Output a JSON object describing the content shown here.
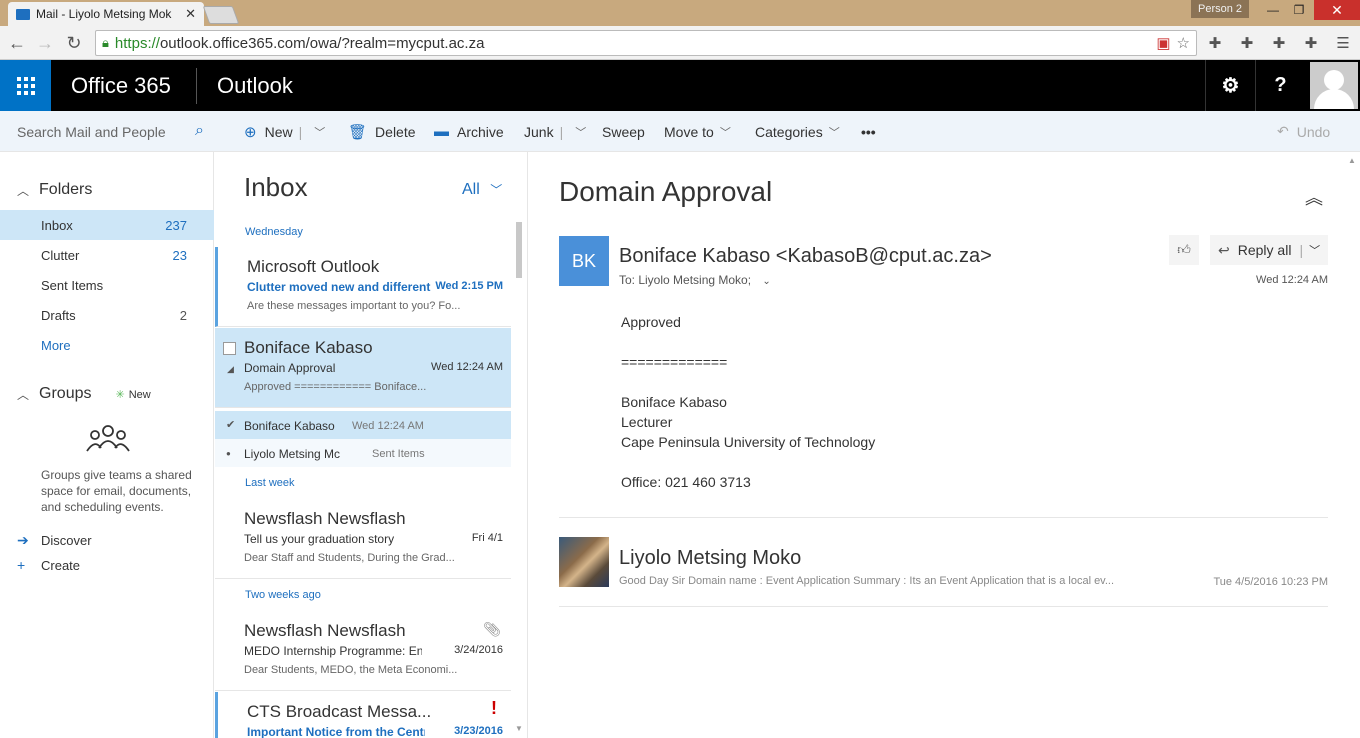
{
  "browser": {
    "tab_title": "Mail - Liyolo Metsing Mok",
    "tab_close": "✕",
    "profile": "Person 2",
    "window_min": "—",
    "window_max": "❐",
    "window_close": "✕",
    "url_scheme": "https://",
    "url_rest": "outlook.office365.com/owa/?realm=mycput.ac.za"
  },
  "o365": {
    "brand": "Office 365",
    "app": "Outlook",
    "settings_glyph": "⚙",
    "help_glyph": "?"
  },
  "command_bar": {
    "search_placeholder": "Search Mail and People",
    "new": "New",
    "delete": "Delete",
    "archive": "Archive",
    "junk": "Junk",
    "sweep": "Sweep",
    "move_to": "Move to",
    "categories": "Categories",
    "more": "•••",
    "undo": "Undo"
  },
  "left_nav": {
    "folders_label": "Folders",
    "folders": [
      {
        "name": "Inbox",
        "count": "237"
      },
      {
        "name": "Clutter",
        "count": "23"
      },
      {
        "name": "Sent Items",
        "count": ""
      },
      {
        "name": "Drafts",
        "count": "2"
      }
    ],
    "more": "More",
    "groups_label": "Groups",
    "groups_new": "New",
    "groups_desc": "Groups give teams a shared space for email, documents, and scheduling events.",
    "discover": "Discover",
    "create": "Create"
  },
  "message_list": {
    "header": "Inbox",
    "filter": "All",
    "groups": {
      "wednesday": "Wednesday",
      "last_week": "Last week",
      "two_weeks": "Two weeks ago"
    },
    "messages": [
      {
        "from": "Microsoft Outlook",
        "subject": "Clutter moved new and different",
        "date": "Wed 2:15 PM",
        "preview": "Are these messages important to you? Fo..."
      },
      {
        "from": "Boniface Kabaso",
        "subject": "Domain Approval",
        "date": "Wed 12:24 AM",
        "preview": "Approved  ============  Boniface..."
      },
      {
        "from": "Newsflash Newsflash",
        "subject": "Tell us your graduation story",
        "date": "Fri 4/1",
        "preview": "Dear Staff and Students, During the Grad..."
      },
      {
        "from": "Newsflash Newsflash",
        "subject": "MEDO Internship Programme: En",
        "date": "3/24/2016",
        "preview": "Dear Students, MEDO, the Meta Economi..."
      },
      {
        "from": "CTS Broadcast Messa...",
        "subject": "Important Notice from the Centr",
        "date": "3/23/2016",
        "preview": ""
      }
    ],
    "thread": [
      {
        "from": "Boniface Kabaso",
        "date": "Wed 12:24 AM"
      },
      {
        "from": "Liyolo Metsing Mc",
        "date": "Sent Items"
      }
    ]
  },
  "reading": {
    "subject": "Domain Approval",
    "initials": "BK",
    "sender": "Boniface Kabaso <KabasoB@cput.ac.za>",
    "to": "To: Liyolo Metsing Moko;",
    "date": "Wed 12:24 AM",
    "reply_all": "Reply all",
    "body": [
      "Approved",
      "=============",
      "Boniface Kabaso",
      "Lecturer",
      "Cape Peninsula University of Technology",
      "Office: 021 460 3713"
    ],
    "sender2": "Liyolo Metsing Moko",
    "preview2": "Good Day Sir Domain name : Event Application Summary : Its an Event Application that is a local ev...",
    "date2": "Tue 4/5/2016 10:23 PM"
  }
}
